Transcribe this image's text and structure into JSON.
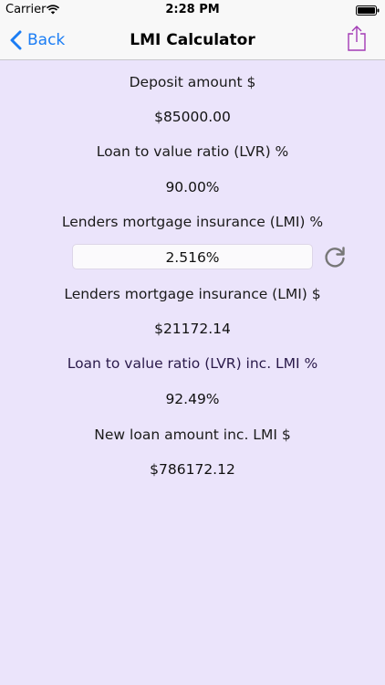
{
  "status_bar": {
    "carrier": "Carrier",
    "time": "2:28 PM"
  },
  "nav": {
    "back_label": "Back",
    "title": "LMI Calculator"
  },
  "fields": {
    "deposit_label": "Deposit amount $",
    "deposit_value": "$85000.00",
    "lvr_label": "Loan to value ratio (LVR) %",
    "lvr_value": "90.00%",
    "lmi_rate_label": "Lenders mortgage insurance (LMI) %",
    "lmi_rate_value": "2.516%",
    "lmi_amount_label": "Lenders mortgage insurance (LMI) $",
    "lmi_amount_value": "$21172.14",
    "lvr_inc_label": "Loan to value ratio (LVR) inc. LMI %",
    "lvr_inc_value": "92.49%",
    "new_loan_label": "New loan amount inc. LMI $",
    "new_loan_value": "$786172.12"
  },
  "colors": {
    "background": "#ebe4fb",
    "accent": "#1b7df4",
    "share_icon": "#a23ab5"
  }
}
